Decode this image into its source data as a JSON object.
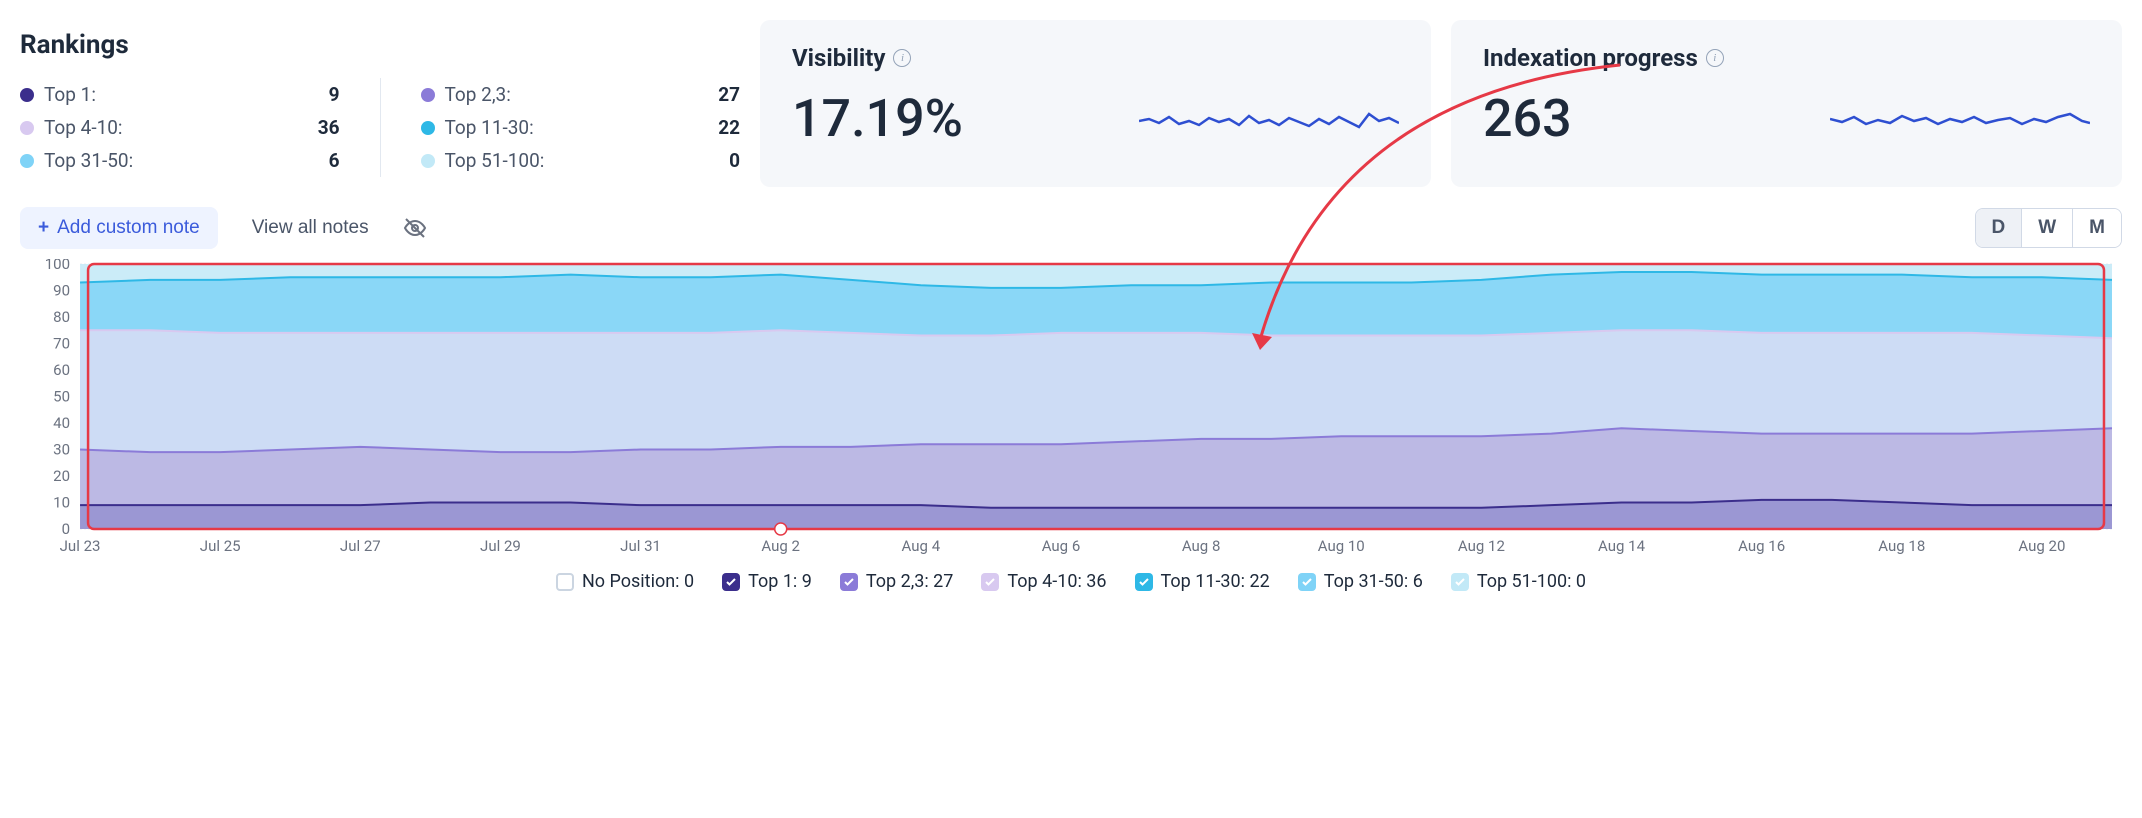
{
  "rankings": {
    "title": "Rankings",
    "left": [
      {
        "label": "Top 1:",
        "value": "9",
        "color": "#3b2e8c"
      },
      {
        "label": "Top 4-10:",
        "value": "36",
        "color": "#d8c9f0"
      },
      {
        "label": "Top 31-50:",
        "value": "6",
        "color": "#7fd3f7"
      }
    ],
    "right": [
      {
        "label": "Top 2,3:",
        "value": "27",
        "color": "#8b7bd8"
      },
      {
        "label": "Top 11-30:",
        "value": "22",
        "color": "#2eb8e6"
      },
      {
        "label": "Top 51-100:",
        "value": "0",
        "color": "#c2e9f7"
      }
    ]
  },
  "visibility": {
    "title": "Visibility",
    "value": "17.19%"
  },
  "indexation": {
    "title": "Indexation progress",
    "value": "263"
  },
  "controls": {
    "add_note": "Add custom note",
    "view_notes": "View all notes",
    "periods": [
      "D",
      "W",
      "M"
    ],
    "active_period": "D"
  },
  "chart_data": {
    "type": "area",
    "ylabel": "",
    "ylim": [
      0,
      100
    ],
    "yticks": [
      0,
      10,
      20,
      30,
      40,
      50,
      60,
      70,
      80,
      90,
      100
    ],
    "categories": [
      "Jul 23",
      "Jul 24",
      "Jul 25",
      "Jul 26",
      "Jul 27",
      "Jul 28",
      "Jul 29",
      "Jul 30",
      "Jul 31",
      "Aug 1",
      "Aug 2",
      "Aug 3",
      "Aug 4",
      "Aug 5",
      "Aug 6",
      "Aug 7",
      "Aug 8",
      "Aug 9",
      "Aug 10",
      "Aug 11",
      "Aug 12",
      "Aug 13",
      "Aug 14",
      "Aug 15",
      "Aug 16",
      "Aug 17",
      "Aug 18",
      "Aug 19",
      "Aug 20",
      "Aug 21"
    ],
    "xtick_every": 2,
    "series": [
      {
        "name": "Top 51-100",
        "color": "#c2e9f7",
        "values": [
          100,
          100,
          100,
          100,
          100,
          100,
          100,
          100,
          100,
          100,
          100,
          100,
          100,
          100,
          100,
          100,
          100,
          100,
          100,
          100,
          100,
          100,
          100,
          100,
          100,
          100,
          100,
          100,
          100,
          100
        ]
      },
      {
        "name": "Top 31-50",
        "color": "#7fd3f7",
        "stroke": "#2eb8e6",
        "values": [
          93,
          94,
          94,
          95,
          95,
          95,
          95,
          96,
          95,
          95,
          96,
          94,
          92,
          91,
          91,
          92,
          92,
          93,
          93,
          93,
          94,
          96,
          97,
          97,
          96,
          96,
          96,
          95,
          95,
          94
        ]
      },
      {
        "name": "Top 11-30",
        "color": "#d8ddf5",
        "stroke": "#d8c9f0",
        "values": [
          75,
          75,
          74,
          74,
          74,
          74,
          74,
          74,
          74,
          74,
          75,
          74,
          73,
          73,
          74,
          74,
          74,
          73,
          73,
          73,
          73,
          74,
          75,
          75,
          74,
          74,
          74,
          74,
          73,
          72
        ]
      },
      {
        "name": "Top 4-10",
        "color": "#b8b3e0",
        "stroke": "#8b7bd8",
        "values": [
          30,
          29,
          29,
          30,
          31,
          30,
          29,
          29,
          30,
          30,
          31,
          31,
          32,
          32,
          32,
          33,
          34,
          34,
          35,
          35,
          35,
          36,
          38,
          37,
          36,
          36,
          36,
          36,
          37,
          38
        ]
      },
      {
        "name": "Top 2,3",
        "color": "#9590d0",
        "stroke": "#3b2e8c",
        "values": [
          9,
          9,
          9,
          9,
          9,
          10,
          10,
          10,
          9,
          9,
          9,
          9,
          9,
          8,
          8,
          8,
          8,
          8,
          8,
          8,
          8,
          9,
          10,
          10,
          11,
          11,
          10,
          9,
          9,
          9
        ]
      }
    ]
  },
  "legend": [
    {
      "label": "No Position: 0",
      "color": "#ffffff",
      "checked": false
    },
    {
      "label": "Top 1: 9",
      "color": "#3b2e8c",
      "checked": true
    },
    {
      "label": "Top 2,3: 27",
      "color": "#8b7bd8",
      "checked": true
    },
    {
      "label": "Top 4-10: 36",
      "color": "#d8c9f0",
      "checked": true
    },
    {
      "label": "Top 11-30: 22",
      "color": "#2eb8e6",
      "checked": true
    },
    {
      "label": "Top 31-50: 6",
      "color": "#7fd3f7",
      "checked": true
    },
    {
      "label": "Top 51-100: 0",
      "color": "#c2e9f7",
      "checked": true
    }
  ]
}
